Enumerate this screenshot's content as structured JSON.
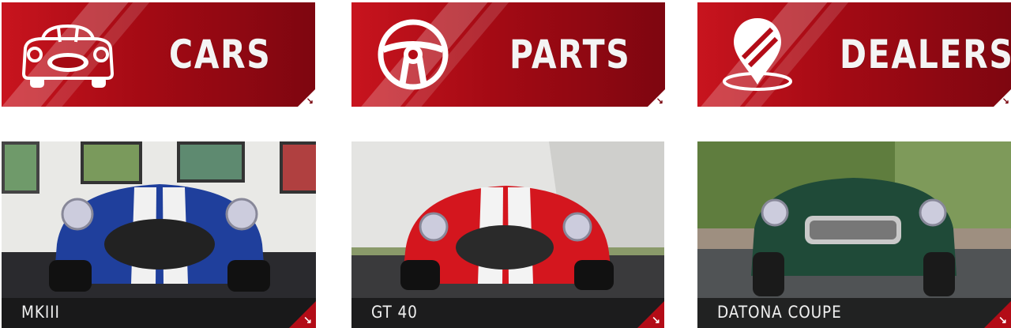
{
  "categories": [
    {
      "label": "CARS",
      "icon": "roadster-car-icon"
    },
    {
      "label": "PARTS",
      "icon": "steering-wheel-icon"
    },
    {
      "label": "DEALERS",
      "icon": "map-pin-icon"
    }
  ],
  "cards": [
    {
      "caption": "MKIII",
      "color": "#1f3f9c"
    },
    {
      "caption": "GT 40",
      "color": "#d4161e"
    },
    {
      "caption": "DATONA COUPE",
      "color": "#1f4a38"
    }
  ],
  "colors": {
    "accent": "#b30c17",
    "banner_dark": "#7e0610"
  }
}
